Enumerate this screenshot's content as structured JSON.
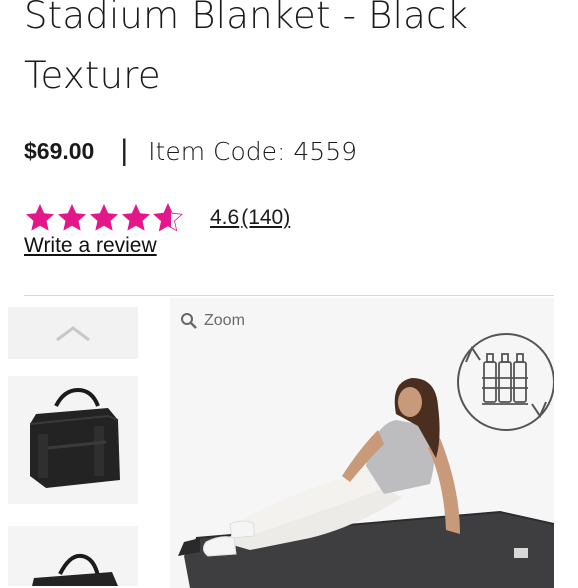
{
  "product": {
    "title": "Stadium Blanket - Black Texture",
    "price": "$69.00",
    "separator": "|",
    "item_code": "Item Code: 4559"
  },
  "rating": {
    "stars": 4.6,
    "max_stars": 5,
    "star_color": "#e5168a",
    "value": "4.6",
    "count": "(140)"
  },
  "write_review": "Write a review",
  "gallery": {
    "zoom_label": "Zoom",
    "thumbnails": [
      "bag-black-front",
      "bag-black-side"
    ]
  }
}
